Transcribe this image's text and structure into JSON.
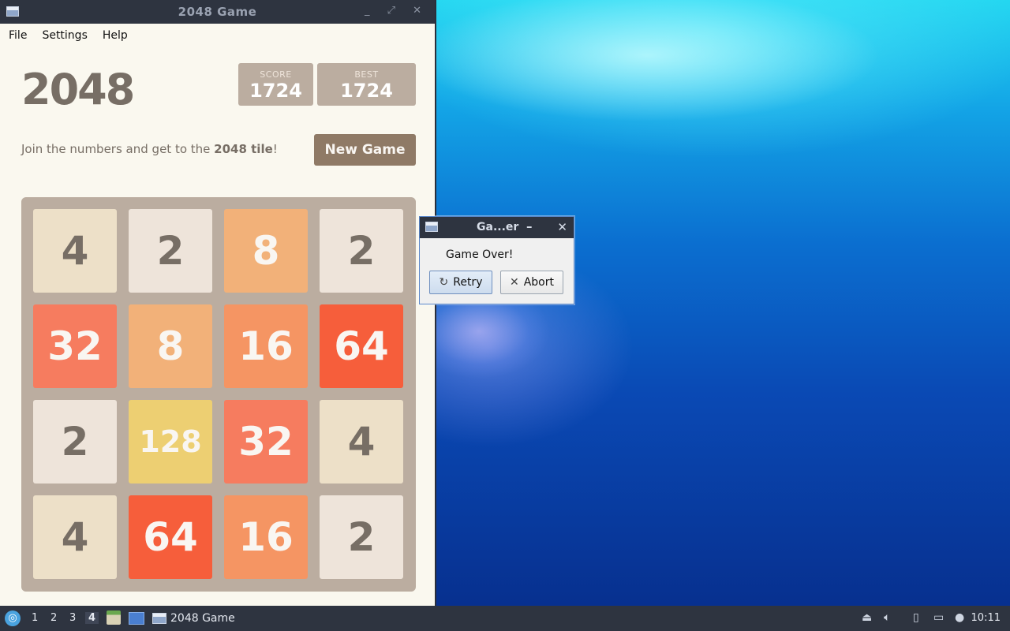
{
  "window": {
    "title": "2048 Game",
    "controls": "_ ⤢ ✕"
  },
  "menu": {
    "items": [
      "File",
      "Settings",
      "Help"
    ]
  },
  "game": {
    "title": "2048",
    "score_label": "SCORE",
    "score_value": "1724",
    "best_label": "BEST",
    "best_value": "1724",
    "intro_prefix": "Join the numbers and get to the ",
    "intro_bold": "2048 tile",
    "intro_suffix": "!",
    "new_game_label": "New Game",
    "board": [
      [
        4,
        2,
        8,
        2
      ],
      [
        32,
        8,
        16,
        64
      ],
      [
        2,
        128,
        32,
        4
      ],
      [
        4,
        64,
        16,
        2
      ]
    ],
    "tile_colors": {
      "2": {
        "bg": "#eee4da",
        "fg": "#776e65"
      },
      "4": {
        "bg": "#ede0c8",
        "fg": "#776e65"
      },
      "8": {
        "bg": "#f2b179",
        "fg": "#f9f6f2"
      },
      "16": {
        "bg": "#f59563",
        "fg": "#f9f6f2"
      },
      "32": {
        "bg": "#f67c5f",
        "fg": "#f9f6f2"
      },
      "64": {
        "bg": "#f65e3b",
        "fg": "#f9f6f2"
      },
      "128": {
        "bg": "#edcf72",
        "fg": "#f9f6f2"
      }
    }
  },
  "dialog": {
    "title": "Ga...er",
    "minimize": "–",
    "close": "✕",
    "message": "Game Over!",
    "retry_icon": "↻",
    "retry_label": "Retry",
    "abort_icon": "✕",
    "abort_label": "Abort"
  },
  "taskbar": {
    "start_icon": "start-menu-icon",
    "workspaces": [
      "1",
      "2",
      "3",
      "4"
    ],
    "active_workspace": "4",
    "task_label": "2048 Game",
    "clock": "10:11"
  }
}
